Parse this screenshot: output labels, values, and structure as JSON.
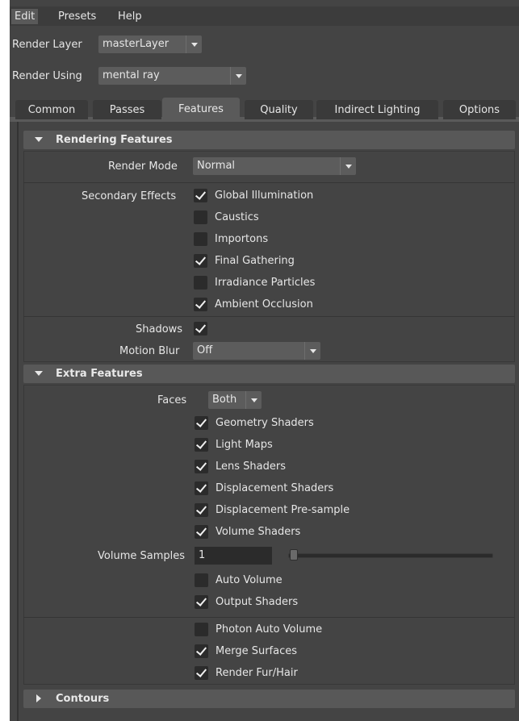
{
  "menubar": {
    "items": [
      "Edit",
      "Presets",
      "Help"
    ]
  },
  "render_layer": {
    "label": "Render Layer",
    "value": "masterLayer"
  },
  "render_using": {
    "label": "Render Using",
    "value": "mental ray"
  },
  "tabs": [
    {
      "label": "Common"
    },
    {
      "label": "Passes"
    },
    {
      "label": "Features",
      "active": true
    },
    {
      "label": "Quality"
    },
    {
      "label": "Indirect Lighting"
    },
    {
      "label": "Options"
    }
  ],
  "rendering_features": {
    "title": "Rendering Features",
    "render_mode": {
      "label": "Render Mode",
      "value": "Normal"
    },
    "secondary_effects": {
      "label": "Secondary Effects",
      "items": [
        {
          "label": "Global Illumination",
          "checked": true
        },
        {
          "label": "Caustics",
          "checked": false
        },
        {
          "label": "Importons",
          "checked": false
        },
        {
          "label": "Final Gathering",
          "checked": true
        },
        {
          "label": "Irradiance Particles",
          "checked": false
        },
        {
          "label": "Ambient Occlusion",
          "checked": true
        }
      ]
    },
    "shadows": {
      "label": "Shadows",
      "checked": true
    },
    "motion_blur": {
      "label": "Motion Blur",
      "value": "Off"
    }
  },
  "extra_features": {
    "title": "Extra Features",
    "faces": {
      "label": "Faces",
      "value": "Both"
    },
    "shader_items": [
      {
        "label": "Geometry Shaders",
        "checked": true
      },
      {
        "label": "Light Maps",
        "checked": true
      },
      {
        "label": "Lens Shaders",
        "checked": true
      },
      {
        "label": "Displacement Shaders",
        "checked": true
      },
      {
        "label": "Displacement Pre-sample",
        "checked": true
      },
      {
        "label": "Volume Shaders",
        "checked": true
      }
    ],
    "volume_samples": {
      "label": "Volume Samples",
      "value": "1",
      "slider_fraction": 0.0
    },
    "volume_items": [
      {
        "label": "Auto Volume",
        "checked": false
      },
      {
        "label": "Output Shaders",
        "checked": true
      }
    ],
    "bottom_items": [
      {
        "label": "Photon Auto Volume",
        "checked": false
      },
      {
        "label": "Merge Surfaces",
        "checked": true
      },
      {
        "label": "Render Fur/Hair",
        "checked": true
      }
    ]
  },
  "contours": {
    "title": "Contours"
  },
  "colors": {
    "panel_bg": "#444444",
    "field_bg": "#2b2b2b",
    "header_bg": "#585858",
    "text": "#e6e6e6"
  },
  "icons": {
    "collapse": "triangle-down-icon",
    "expand": "triangle-right-icon",
    "dropdown": "chevron-down-icon",
    "check": "checkmark-icon"
  }
}
